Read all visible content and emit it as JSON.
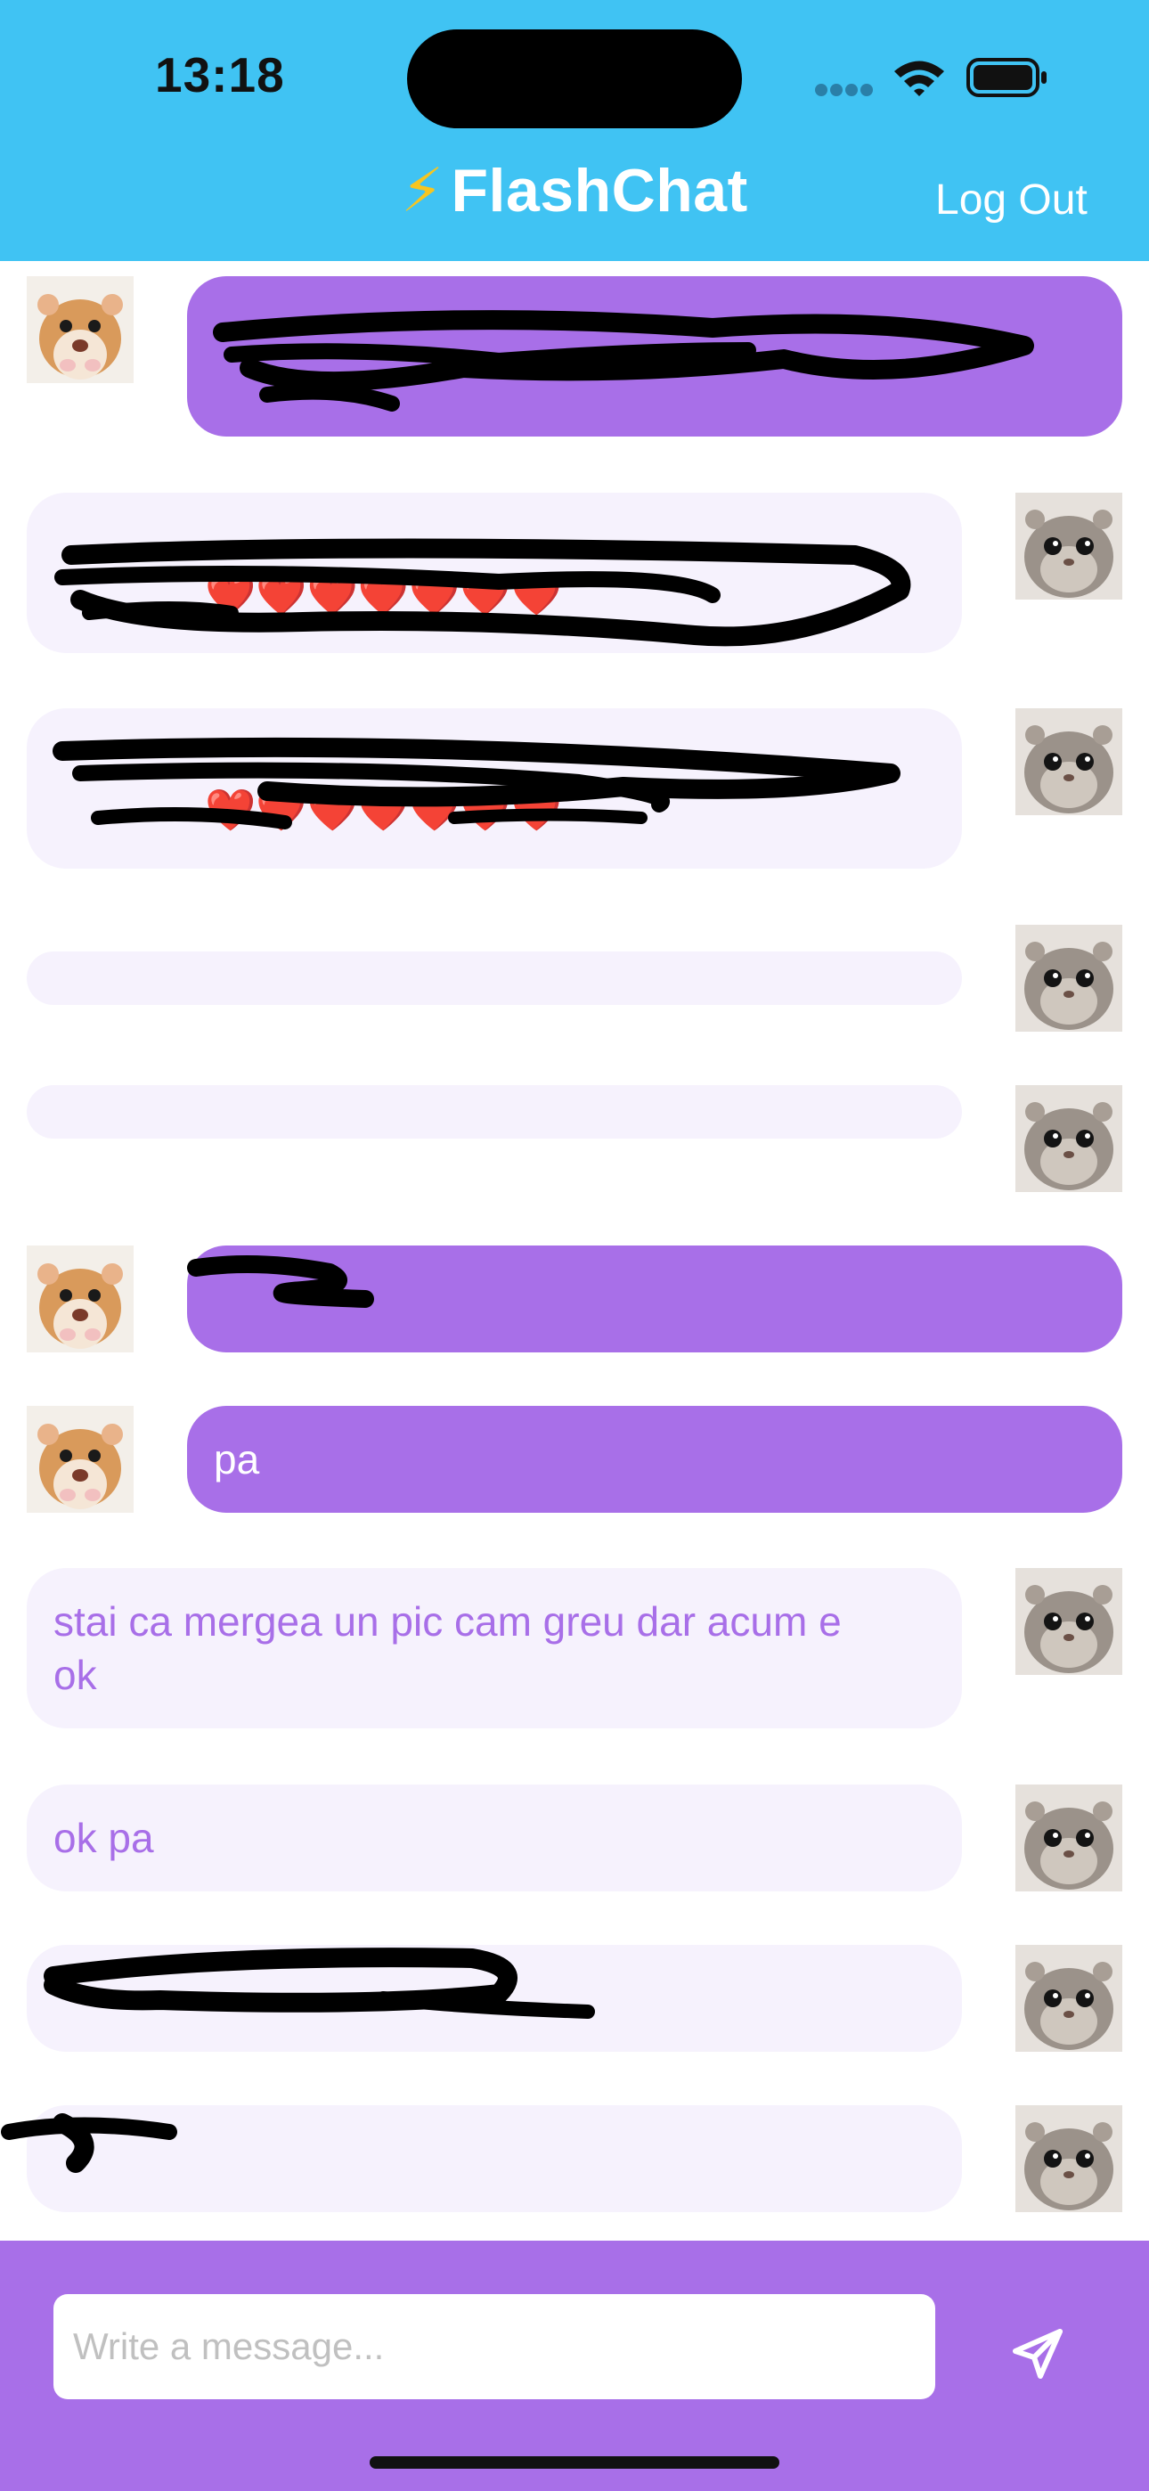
{
  "status_bar": {
    "time": "13:18"
  },
  "header": {
    "bolt": "⚡",
    "title": "FlashChat",
    "logout_label": "Log Out"
  },
  "messages": [
    {
      "sender": "me",
      "text": ""
    },
    {
      "sender": "other",
      "text": ""
    },
    {
      "sender": "other",
      "text": ""
    },
    {
      "sender": "other",
      "text": ""
    },
    {
      "sender": "other",
      "text": ""
    },
    {
      "sender": "me",
      "text": ""
    },
    {
      "sender": "me",
      "text": "pa"
    },
    {
      "sender": "other",
      "text": "stai ca mergea un pic cam greu dar acum e ok"
    },
    {
      "sender": "other",
      "text": "ok pa"
    },
    {
      "sender": "other",
      "text": ""
    },
    {
      "sender": "other",
      "text": ""
    }
  ],
  "hearts": "❤️❤️❤️❤️❤️❤️❤️",
  "composer": {
    "placeholder": "Write a message..."
  },
  "colors": {
    "header_bg": "#40c3f3",
    "accent": "#a86fe8",
    "other_bubble_bg": "#f6f2fd",
    "heart": "#e8231f"
  },
  "icons": [
    "wifi-icon",
    "battery-icon",
    "send-icon",
    "hamster-avatar-icon"
  ]
}
